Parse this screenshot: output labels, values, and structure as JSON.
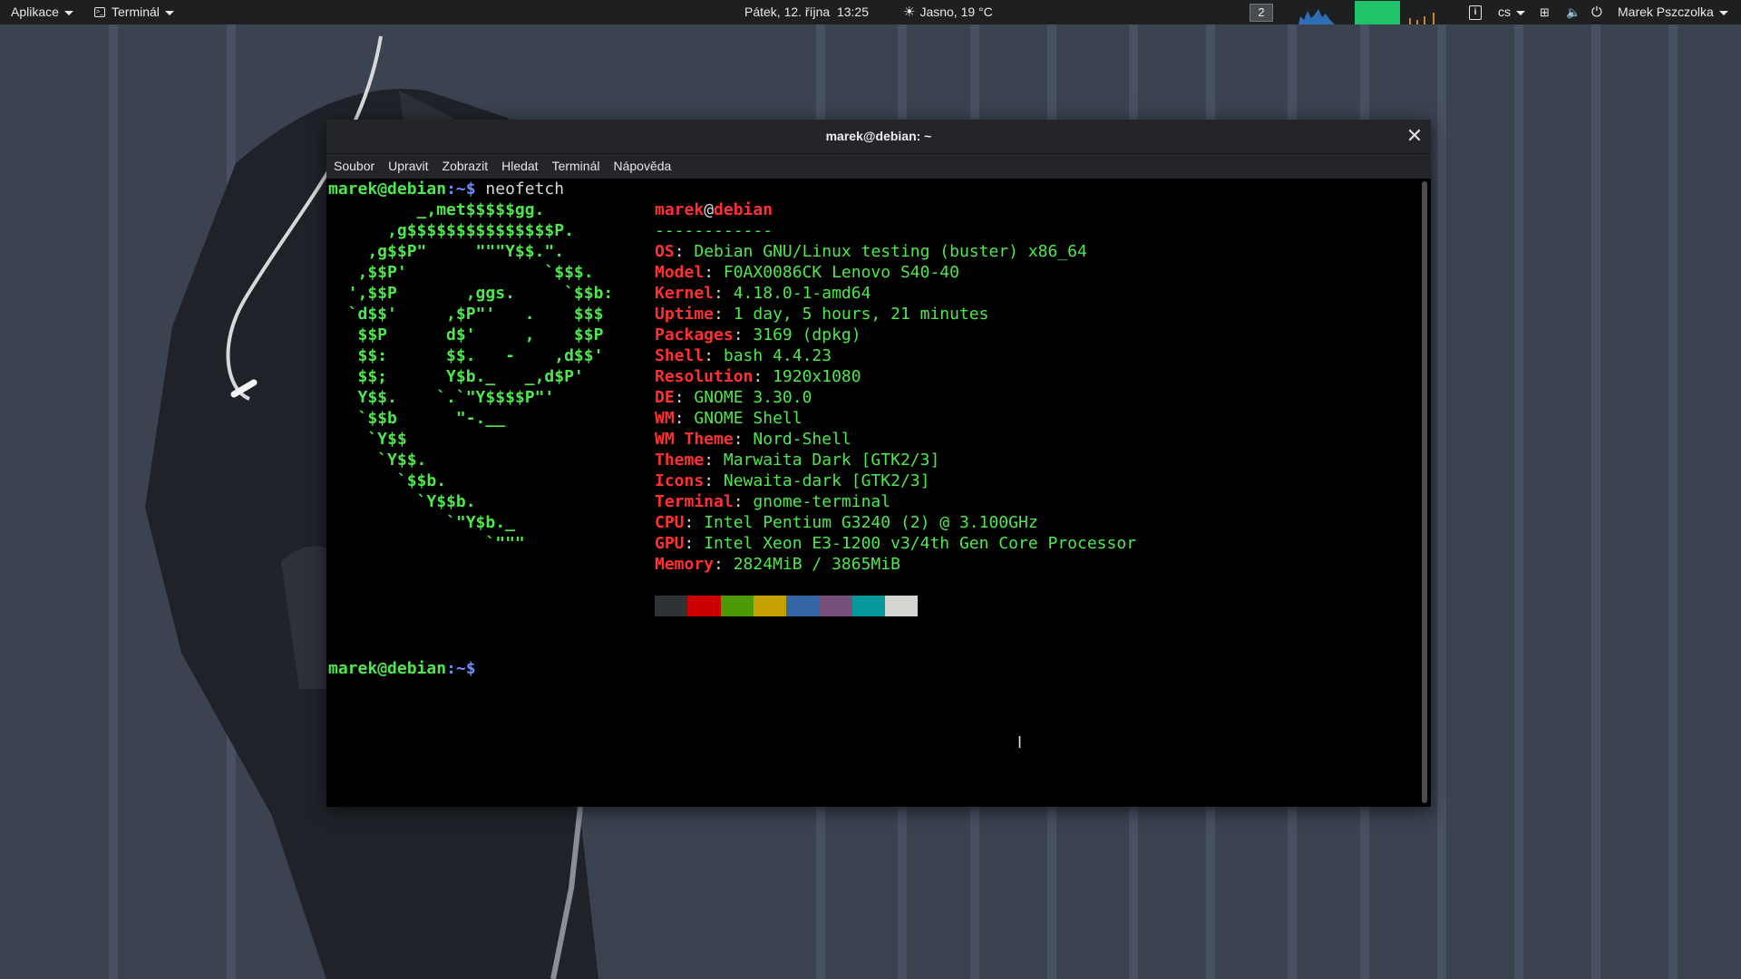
{
  "topbar": {
    "apps_label": "Aplikace",
    "terminal_label": "Terminál",
    "datetime": "Pátek, 12. října  13:25",
    "weather": "Jasno, 19 °C",
    "workspace": "2",
    "language": "cs",
    "user": "Marek Pszczolka"
  },
  "window": {
    "title": "marek@debian: ~",
    "menu": [
      "Soubor",
      "Upravit",
      "Zobrazit",
      "Hledat",
      "Terminál",
      "Nápověda"
    ]
  },
  "terminal": {
    "user": "marek",
    "host": "debian",
    "prompt_path": ":~$",
    "command": " neofetch",
    "separator": "------------",
    "logo": [
      "         _,met$$$$$gg.",
      "      ,g$$$$$$$$$$$$$$$P.",
      "    ,g$$P\"     \"\"\"Y$$.\".",
      "   ,$$P'              `$$$.",
      "  ',$$P       ,ggs.     `$$b:",
      "  `d$$'     ,$P\"'   .    $$$",
      "   $$P      d$'     ,    $$P",
      "   $$:      $$.   -    ,d$$'",
      "   $$;      Y$b._   _,d$P'",
      "   Y$$.    `.`\"Y$$$$P\"'",
      "   `$$b      \"-.__",
      "    `Y$$",
      "     `Y$$.",
      "       `$$b.",
      "         `Y$$b.",
      "            `\"Y$b._",
      "                `\"\"\""
    ],
    "info": [
      {
        "key": "OS",
        "value": "Debian GNU/Linux testing (buster) x86_64"
      },
      {
        "key": "Model",
        "value": "F0AX0086CK Lenovo S40-40"
      },
      {
        "key": "Kernel",
        "value": "4.18.0-1-amd64"
      },
      {
        "key": "Uptime",
        "value": "1 day, 5 hours, 21 minutes"
      },
      {
        "key": "Packages",
        "value": "3169 (dpkg)"
      },
      {
        "key": "Shell",
        "value": "bash 4.4.23"
      },
      {
        "key": "Resolution",
        "value": "1920x1080"
      },
      {
        "key": "DE",
        "value": "GNOME 3.30.0"
      },
      {
        "key": "WM",
        "value": "GNOME Shell"
      },
      {
        "key": "WM Theme",
        "value": "Nord-Shell"
      },
      {
        "key": "Theme",
        "value": "Marwaita Dark [GTK2/3]"
      },
      {
        "key": "Icons",
        "value": "Newaita-dark [GTK2/3]"
      },
      {
        "key": "Terminal",
        "value": "gnome-terminal"
      },
      {
        "key": "CPU",
        "value": "Intel Pentium G3240 (2) @ 3.100GHz"
      },
      {
        "key": "GPU",
        "value": "Intel Xeon E3-1200 v3/4th Gen Core Processor"
      },
      {
        "key": "Memory",
        "value": "2824MiB / 3865MiB"
      }
    ],
    "palette": [
      "#2e3436",
      "#cc0000",
      "#4e9a06",
      "#c4a000",
      "#3465a4",
      "#75507b",
      "#06989a",
      "#d3d7cf"
    ]
  }
}
